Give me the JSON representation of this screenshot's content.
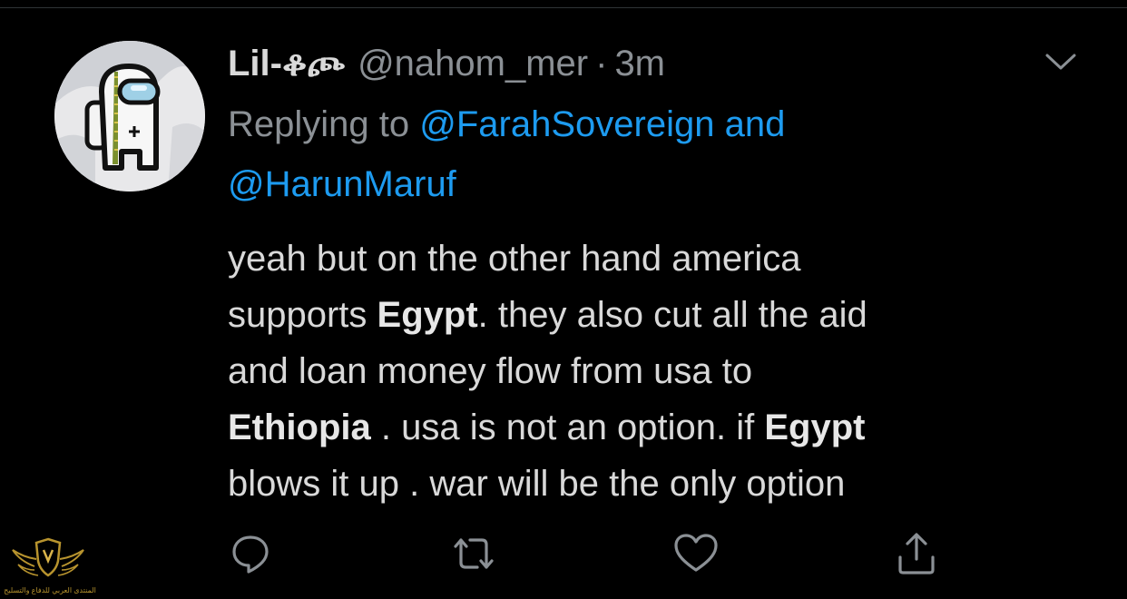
{
  "tweet": {
    "display_name": "Lil-ቆጮ",
    "handle": "@nahom_mer",
    "separator": "·",
    "time": "3m",
    "replying_prefix": "Replying to",
    "reply_mention_1": "@FarahSovereign",
    "reply_conjunction": "and",
    "reply_mention_2": "@HarunMaruf",
    "body_lines": [
      [
        {
          "text": "yeah but on the other hand  america",
          "bold": false
        }
      ],
      [
        {
          "text": "supports ",
          "bold": false
        },
        {
          "text": "Egypt",
          "bold": true
        },
        {
          "text": ". they also cut all the aid",
          "bold": false
        }
      ],
      [
        {
          "text": "and loan  money flow from usa to",
          "bold": false
        }
      ],
      [
        {
          "text": "Ethiopia",
          "bold": true
        },
        {
          "text": " .  usa is not an option. if ",
          "bold": false
        },
        {
          "text": "Egypt",
          "bold": true
        }
      ],
      [
        {
          "text": "blows it up . war will be the only option",
          "bold": false
        }
      ]
    ]
  },
  "actions": [
    {
      "name": "reply",
      "icon": "speech-bubble-icon"
    },
    {
      "name": "retweet",
      "icon": "retweet-icon"
    },
    {
      "name": "like",
      "icon": "heart-icon"
    },
    {
      "name": "share",
      "icon": "share-icon"
    }
  ],
  "watermark": {
    "caption": "المنتدى العربي للدفاع والتسليح"
  },
  "colors": {
    "background": "#000000",
    "text": "#d9d9d9",
    "muted": "#8b9095",
    "link": "#1d9bf0",
    "icon": "#8b9095",
    "watermark_gold": "#b8942e"
  }
}
